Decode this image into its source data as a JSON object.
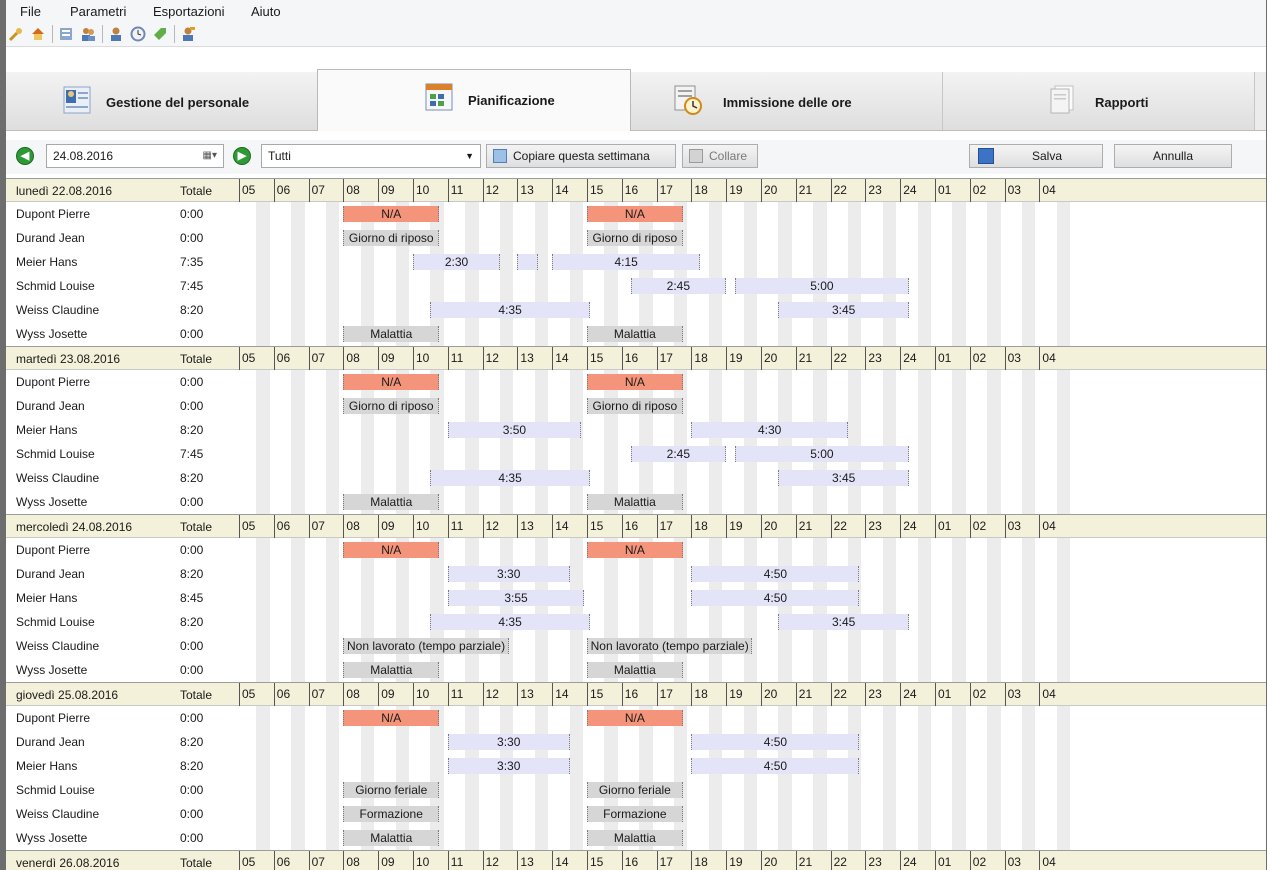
{
  "menu": [
    "File",
    "Parametri",
    "Esportazioni",
    "Aiuto"
  ],
  "toolbar_icons": [
    "wrench-icon",
    "home-icon",
    "document-icon",
    "users-icon",
    "user-icon",
    "clock-icon",
    "tag-icon",
    "user-edit-icon"
  ],
  "tabs": [
    {
      "label": "Gestione del personale",
      "icon": "staff-icon"
    },
    {
      "label": "Pianificazione",
      "icon": "planning-icon"
    },
    {
      "label": "Immissione delle ore",
      "icon": "time-entry-icon"
    },
    {
      "label": "Rapporti",
      "icon": "reports-icon"
    }
  ],
  "controls": {
    "date_value": "24.08.2016",
    "filter_value": "Tutti",
    "copy_label": "Copiare questa settimana",
    "paste_label": "Collare",
    "save_label": "Salva",
    "cancel_label": "Annulla"
  },
  "hours": [
    "05",
    "06",
    "07",
    "08",
    "09",
    "10",
    "11",
    "12",
    "13",
    "14",
    "15",
    "16",
    "17",
    "18",
    "19",
    "20",
    "21",
    "22",
    "23",
    "24",
    "01",
    "02",
    "03",
    "04"
  ],
  "total_label": "Totale",
  "colors": {
    "na": "#f4947a",
    "absence": "#d6d6d6",
    "work": "#e3e4f8",
    "header": "#f3f1da"
  },
  "days": [
    {
      "title": "lunedì 22.08.2016",
      "rows": [
        {
          "name": "Dupont Pierre",
          "total": "0:00",
          "bars": [
            {
              "s": 8,
              "e": 10.75,
              "t": "na",
              "label": "N/A"
            },
            {
              "s": 15,
              "e": 17.75,
              "t": "na",
              "label": "N/A"
            }
          ]
        },
        {
          "name": "Durand Jean",
          "total": "0:00",
          "bars": [
            {
              "s": 8,
              "e": 10.75,
              "t": "grey",
              "label": "Giorno di riposo"
            },
            {
              "s": 15,
              "e": 17.75,
              "t": "grey",
              "label": "Giorno di riposo"
            }
          ]
        },
        {
          "name": "Meier Hans",
          "total": "7:35",
          "bars": [
            {
              "s": 10,
              "e": 12.5,
              "t": "work",
              "label": "2:30"
            },
            {
              "s": 13,
              "e": 13.6,
              "t": "work",
              "label": ""
            },
            {
              "s": 14,
              "e": 18.25,
              "t": "work",
              "label": "4:15"
            }
          ]
        },
        {
          "name": "Schmid Louise",
          "total": "7:45",
          "bars": [
            {
              "s": 16.25,
              "e": 19,
              "t": "work",
              "label": "2:45"
            },
            {
              "s": 19.25,
              "e": 24.25,
              "t": "work",
              "label": "5:00"
            }
          ]
        },
        {
          "name": "Weiss Claudine",
          "total": "8:20",
          "bars": [
            {
              "s": 10.5,
              "e": 15.08,
              "t": "work",
              "label": "4:35"
            },
            {
              "s": 20.5,
              "e": 24.25,
              "t": "work",
              "label": "3:45"
            }
          ]
        },
        {
          "name": "Wyss Josette",
          "total": "0:00",
          "bars": [
            {
              "s": 8,
              "e": 10.75,
              "t": "grey",
              "label": "Malattia"
            },
            {
              "s": 15,
              "e": 17.75,
              "t": "grey",
              "label": "Malattia"
            }
          ]
        }
      ]
    },
    {
      "title": "martedì 23.08.2016",
      "rows": [
        {
          "name": "Dupont Pierre",
          "total": "0:00",
          "bars": [
            {
              "s": 8,
              "e": 10.75,
              "t": "na",
              "label": "N/A"
            },
            {
              "s": 15,
              "e": 17.75,
              "t": "na",
              "label": "N/A"
            }
          ]
        },
        {
          "name": "Durand Jean",
          "total": "0:00",
          "bars": [
            {
              "s": 8,
              "e": 10.75,
              "t": "grey",
              "label": "Giorno di riposo"
            },
            {
              "s": 15,
              "e": 17.75,
              "t": "grey",
              "label": "Giorno di riposo"
            }
          ]
        },
        {
          "name": "Meier Hans",
          "total": "8:20",
          "bars": [
            {
              "s": 11,
              "e": 14.83,
              "t": "work",
              "label": "3:50"
            },
            {
              "s": 18,
              "e": 22.5,
              "t": "work",
              "label": "4:30"
            }
          ]
        },
        {
          "name": "Schmid Louise",
          "total": "7:45",
          "bars": [
            {
              "s": 16.25,
              "e": 19,
              "t": "work",
              "label": "2:45"
            },
            {
              "s": 19.25,
              "e": 24.25,
              "t": "work",
              "label": "5:00"
            }
          ]
        },
        {
          "name": "Weiss Claudine",
          "total": "8:20",
          "bars": [
            {
              "s": 10.5,
              "e": 15.08,
              "t": "work",
              "label": "4:35"
            },
            {
              "s": 20.5,
              "e": 24.25,
              "t": "work",
              "label": "3:45"
            }
          ]
        },
        {
          "name": "Wyss Josette",
          "total": "0:00",
          "bars": [
            {
              "s": 8,
              "e": 10.75,
              "t": "grey",
              "label": "Malattia"
            },
            {
              "s": 15,
              "e": 17.75,
              "t": "grey",
              "label": "Malattia"
            }
          ]
        }
      ]
    },
    {
      "title": "mercoledì 24.08.2016",
      "rows": [
        {
          "name": "Dupont Pierre",
          "total": "0:00",
          "bars": [
            {
              "s": 8,
              "e": 10.75,
              "t": "na",
              "label": "N/A"
            },
            {
              "s": 15,
              "e": 17.75,
              "t": "na",
              "label": "N/A"
            }
          ]
        },
        {
          "name": "Durand Jean",
          "total": "8:20",
          "bars": [
            {
              "s": 11,
              "e": 14.5,
              "t": "work",
              "label": "3:30"
            },
            {
              "s": 18,
              "e": 22.83,
              "t": "work",
              "label": "4:50"
            }
          ]
        },
        {
          "name": "Meier Hans",
          "total": "8:45",
          "bars": [
            {
              "s": 11,
              "e": 14.92,
              "t": "work",
              "label": "3:55"
            },
            {
              "s": 18,
              "e": 22.83,
              "t": "work",
              "label": "4:50"
            }
          ]
        },
        {
          "name": "Schmid Louise",
          "total": "8:20",
          "bars": [
            {
              "s": 10.5,
              "e": 15.08,
              "t": "work",
              "label": "4:35"
            },
            {
              "s": 20.5,
              "e": 24.25,
              "t": "work",
              "label": "3:45"
            }
          ]
        },
        {
          "name": "Weiss Claudine",
          "total": "0:00",
          "bars": [
            {
              "s": 8,
              "e": 12.75,
              "t": "grey",
              "label": "Non lavorato (tempo parziale)"
            },
            {
              "s": 15,
              "e": 19.75,
              "t": "grey",
              "label": "Non lavorato (tempo parziale)"
            }
          ]
        },
        {
          "name": "Wyss Josette",
          "total": "0:00",
          "bars": [
            {
              "s": 8,
              "e": 10.75,
              "t": "grey",
              "label": "Malattia"
            },
            {
              "s": 15,
              "e": 17.75,
              "t": "grey",
              "label": "Malattia"
            }
          ]
        }
      ]
    },
    {
      "title": "giovedì 25.08.2016",
      "rows": [
        {
          "name": "Dupont Pierre",
          "total": "0:00",
          "bars": [
            {
              "s": 8,
              "e": 10.75,
              "t": "na",
              "label": "N/A"
            },
            {
              "s": 15,
              "e": 17.75,
              "t": "na",
              "label": "N/A"
            }
          ]
        },
        {
          "name": "Durand Jean",
          "total": "8:20",
          "bars": [
            {
              "s": 11,
              "e": 14.5,
              "t": "work",
              "label": "3:30"
            },
            {
              "s": 18,
              "e": 22.83,
              "t": "work",
              "label": "4:50"
            }
          ]
        },
        {
          "name": "Meier Hans",
          "total": "8:20",
          "bars": [
            {
              "s": 11,
              "e": 14.5,
              "t": "work",
              "label": "3:30"
            },
            {
              "s": 18,
              "e": 22.83,
              "t": "work",
              "label": "4:50"
            }
          ]
        },
        {
          "name": "Schmid Louise",
          "total": "0:00",
          "bars": [
            {
              "s": 8,
              "e": 10.75,
              "t": "grey",
              "label": "Giorno feriale"
            },
            {
              "s": 15,
              "e": 17.75,
              "t": "grey",
              "label": "Giorno feriale"
            }
          ]
        },
        {
          "name": "Weiss Claudine",
          "total": "0:00",
          "bars": [
            {
              "s": 8,
              "e": 10.75,
              "t": "grey",
              "label": "Formazione"
            },
            {
              "s": 15,
              "e": 17.75,
              "t": "grey",
              "label": "Formazione"
            }
          ]
        },
        {
          "name": "Wyss Josette",
          "total": "0:00",
          "bars": [
            {
              "s": 8,
              "e": 10.75,
              "t": "grey",
              "label": "Malattia"
            },
            {
              "s": 15,
              "e": 17.75,
              "t": "grey",
              "label": "Malattia"
            }
          ]
        }
      ]
    },
    {
      "title": "venerdì 26.08.2016",
      "rows": []
    }
  ]
}
